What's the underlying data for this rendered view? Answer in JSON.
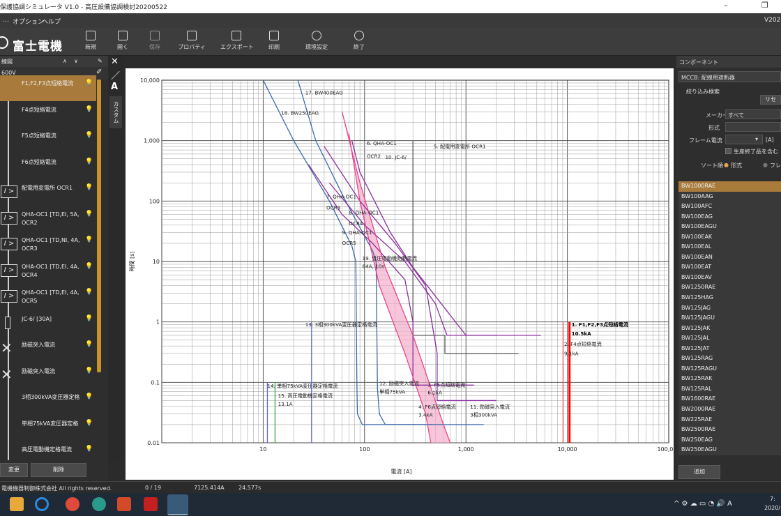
{
  "titlebar": {
    "title": "保護協調シミュレータ V1.0 - 高圧設備協調検討20200522",
    "minimize": "–",
    "restore": "❐"
  },
  "menu": {
    "options": "オプション",
    "help": "ヘルプ",
    "version": "V202"
  },
  "brand": {
    "name": "富士電機"
  },
  "toolbar": [
    "新規",
    "開く",
    "保存",
    "プロパティ",
    "エクスポート",
    "印刷",
    "環境設定",
    "終了"
  ],
  "left_panel": {
    "header": "線図",
    "voltage": "600V",
    "items": [
      {
        "label": "F1,F2,F3点短絡電流",
        "symbol": "none",
        "selected": true
      },
      {
        "label": "F4点短絡電流",
        "symbol": "none"
      },
      {
        "label": "F5点短絡電流",
        "symbol": "none"
      },
      {
        "label": "F6点短絡電流",
        "symbol": "none"
      },
      {
        "label": "配電用変電所 OCR1",
        "symbol": "relay"
      },
      {
        "label": "QHA-OC1 [TD,EI, 5A, OCR2",
        "symbol": "relay"
      },
      {
        "label": "QHA-OC1 [TD,NI, 4A, OCR3",
        "symbol": "relay"
      },
      {
        "label": "QHA-OC1 [TD,EI, 4A, OCR4",
        "symbol": "relay"
      },
      {
        "label": "QHA-OC1 [TD,EI, 4A, OCR5",
        "symbol": "relay"
      },
      {
        "label": "JC-6/ [30A]",
        "symbol": "fuse"
      },
      {
        "label": "励磁突入電流",
        "symbol": "x"
      },
      {
        "label": "励磁突入電流",
        "symbol": "x"
      },
      {
        "label": "3相300kVA変圧器定格",
        "symbol": "none"
      },
      {
        "label": "単相75kVA変圧器定格",
        "symbol": "none"
      },
      {
        "label": "高圧電動機定格電流",
        "symbol": "none"
      }
    ],
    "btn_change": "変更",
    "btn_delete": "削除"
  },
  "side_tab": "カスタム",
  "chart_data": {
    "type": "line",
    "xlabel": "電流 [A]",
    "ylabel": "時間 [s]",
    "x_scale": "log",
    "y_scale": "log",
    "xlim": [
      1,
      100000
    ],
    "ylim": [
      0.01,
      10000
    ],
    "x_ticks": [
      "10",
      "100",
      "1,000",
      "10,000",
      "100,000"
    ],
    "y_ticks": [
      "10,000",
      "1,000",
      "100",
      "10",
      "1",
      "0.1",
      "0.01"
    ],
    "grid": true,
    "annotations": [
      "17. BW400EAG",
      "18. BW250EAG",
      "6. QHA-OC1",
      "OCR2",
      "10. JC-6/",
      "5. 配電用変電所 OCR1",
      "7. QHA-OC1",
      "OCR3",
      "8. QHA-OC1",
      "OCR4",
      "9. QHA-OC1",
      "OCR5",
      "19. 低圧電動機始動電流",
      "64A, 10s",
      "13. 3相300kVA変圧器定格電流",
      "1. F1,F2,F3点短絡電流",
      "10.5kA",
      "2. F4点短絡電流",
      "9.1kA",
      "14. 単相75kVA変圧器定格電流",
      "15. 高圧電動機定格電流",
      "13.1A",
      "12. 励磁突入電流",
      "単相75kVA",
      "3. F5点短絡電流",
      "6.1kA",
      "4. F6点短絡電流",
      "3.4kA",
      "11. 励磁突入電流",
      "3相300kVA"
    ],
    "series": [
      {
        "name": "17. BW400EAG",
        "color": "#3b6aa8",
        "points": [
          [
            10,
            10000
          ],
          [
            20,
            1000
          ],
          [
            45,
            100
          ],
          [
            75,
            18
          ],
          [
            82,
            10
          ],
          [
            84,
            0.1
          ],
          [
            85,
            0.03
          ],
          [
            95,
            0.02
          ],
          [
            470,
            0.02
          ]
        ]
      },
      {
        "name": "18. BW250EAG",
        "color": "#3b6aa8",
        "points": [
          [
            22,
            10000
          ],
          [
            33,
            1000
          ],
          [
            65,
            100
          ],
          [
            120,
            15
          ],
          [
            130,
            10
          ],
          [
            134,
            0.08
          ],
          [
            140,
            0.03
          ],
          [
            160,
            0.02
          ],
          [
            1500,
            0.02
          ]
        ]
      },
      {
        "name": "5. 配電用変電所 OCR1",
        "color": "#555555",
        "points": [
          [
            300,
            1000
          ],
          [
            300,
            0.6
          ],
          [
            620,
            0.6
          ],
          [
            620,
            0.3
          ],
          [
            3300,
            0.3
          ]
        ]
      },
      {
        "name": "6. QHA-OC1 OCR2",
        "color": "#8b2fa0",
        "points": [
          [
            75,
            1000
          ],
          [
            90,
            300
          ],
          [
            180,
            30
          ],
          [
            300,
            8
          ],
          [
            600,
            1.8
          ],
          [
            1000,
            0.6
          ],
          [
            5500,
            0.6
          ]
        ]
      },
      {
        "name": "7. QHA-OC1 OCR3",
        "color": "#8b2fa0",
        "points": [
          [
            45,
            200
          ],
          [
            100,
            40
          ],
          [
            250,
            10
          ],
          [
            500,
            2
          ],
          [
            650,
            0.6
          ],
          [
            2000,
            0.6
          ]
        ]
      },
      {
        "name": "8. QHA-OC1 OCR4",
        "color": "#8b2fa0",
        "points": [
          [
            40,
            800
          ],
          [
            90,
            100
          ],
          [
            200,
            20
          ],
          [
            400,
            4
          ],
          [
            520,
            0.3
          ],
          [
            520,
            0.05
          ],
          [
            2000,
            0.05
          ]
        ]
      },
      {
        "name": "9. QHA-OC1 OCR5",
        "color": "#8b2fa0",
        "points": [
          [
            28,
            400
          ],
          [
            60,
            60
          ],
          [
            120,
            20
          ],
          [
            250,
            5
          ],
          [
            300,
            1
          ],
          [
            300,
            0.09
          ],
          [
            1200,
            0.09
          ]
        ]
      },
      {
        "name": "10. JC-6/ max",
        "color": "#e8468c",
        "points": [
          [
            60,
            3000
          ],
          [
            90,
            200
          ],
          [
            160,
            8
          ],
          [
            300,
            0.6
          ],
          [
            600,
            0.02
          ],
          [
            700,
            0.01
          ]
        ]
      },
      {
        "name": "10. JC-6/ min",
        "color": "#e8468c",
        "points": [
          [
            70,
            1300
          ],
          [
            90,
            100
          ],
          [
            140,
            4
          ],
          [
            250,
            0.3
          ],
          [
            400,
            0.03
          ],
          [
            450,
            0.01
          ]
        ]
      },
      {
        "name": "1. F1,F2,F3点短絡電流",
        "color": "#ff0000",
        "points": [
          [
            10500,
            1
          ],
          [
            10500,
            0.01
          ]
        ]
      },
      {
        "name": "2. F4点短絡電流",
        "color": "#ff6060",
        "points": [
          [
            9100,
            1
          ],
          [
            9100,
            0.01
          ]
        ]
      },
      {
        "name": "13. 3相300kVA変圧器定格電流",
        "color": "#6666dd",
        "points": [
          [
            30,
            1
          ],
          [
            30,
            0.01
          ]
        ]
      },
      {
        "name": "14. 単相75kVA変圧器定格電流",
        "color": "#6666dd",
        "points": [
          [
            11,
            0.1
          ],
          [
            11,
            0.01
          ]
        ]
      },
      {
        "name": "15. 高圧電動機定格電流",
        "color": "#33aa33",
        "points": [
          [
            13.1,
            0.1
          ],
          [
            13.1,
            0.01
          ]
        ]
      }
    ]
  },
  "right_panel": {
    "header": "コンポーネント",
    "category": "MCCB: 配線用遮断器",
    "filter_title": "絞り込み検索",
    "reset": "リセ",
    "maker_label": "メーカー",
    "maker_value": "すべて",
    "type_label": "形式",
    "frame_label": "フレーム電流",
    "frame_unit": "[A]",
    "discontinued_label": "生産終了品を含む",
    "sort_label": "ソート順",
    "sort_opt1": "形式",
    "sort_opt2": "フレ",
    "components": [
      "BW1000RAE",
      "BW100AAG",
      "BW100AFC",
      "BW100EAG",
      "BW100EAGU",
      "BW100EAK",
      "BW100EAL",
      "BW100EAN",
      "BW100EAT",
      "BW100EAV",
      "BW1250RAE",
      "BW125HAG",
      "BW125JAG",
      "BW125JAGU",
      "BW125JAK",
      "BW125JAL",
      "BW125JAT",
      "BW125RAG",
      "BW125RAGU",
      "BW125RAK",
      "BW125RAL",
      "BW1600RAE",
      "BW2000RAE",
      "BW225RAE",
      "BW2500RAE",
      "BW250EAG",
      "BW250EAGU"
    ],
    "add": "追加"
  },
  "status": {
    "copyright": "電機機器制御株式会社 All rights reserved.",
    "count": "0 / 19",
    "current": "7125.414A",
    "time": "24.577s"
  },
  "taskbar": {
    "tray": "^ ⚙ ☁ ▭ ◔ 🔊 A",
    "clock": "7:",
    "date": "2020/"
  }
}
